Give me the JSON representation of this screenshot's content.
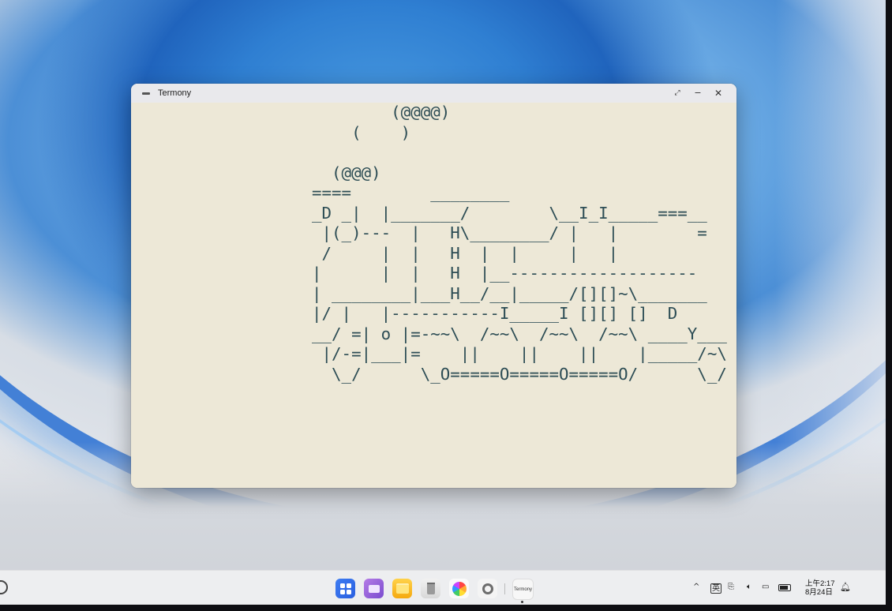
{
  "window": {
    "title": "Termony",
    "controls": {
      "restore": "⤢",
      "minimize": "−",
      "close": "✕"
    }
  },
  "terminal": {
    "content": "        (@@@@)\n    (    )\n\n  (@@@)\n====        ________\n_D _|  |_______/        \\__I_I_____===__\n |(_)---  |   H\\________/ |   |        =\n /     |  |   H  |  |     |   |\n|      |  |   H  |__-------------------\n| ________|___H__/__|_____/[][]~\\_______\n|/ |   |-----------I_____I [][] []  D\n__/ =| o |=-~~\\  /~~\\  /~~\\  /~~\\ ____Y___\n |/-=|___|=    ||    ||    ||    |_____/~\\\n  \\_/      \\_O=====O=====O=====O/      \\_/"
  },
  "taskbar": {
    "dock": [
      {
        "name": "launcher",
        "icon": "grid-icon"
      },
      {
        "name": "multitasking",
        "icon": "windows-icon"
      },
      {
        "name": "files",
        "icon": "folder-icon"
      },
      {
        "name": "trash",
        "icon": "trash-icon"
      },
      {
        "name": "gallery",
        "icon": "flower-icon"
      },
      {
        "name": "settings",
        "icon": "gear-icon"
      },
      {
        "name": "termony",
        "icon": "termony-icon",
        "label": "Termony"
      }
    ],
    "tray": {
      "expand": "^",
      "ime": "英",
      "clipboard": "clipboard-icon",
      "volume": "speaker-icon",
      "cast": "cast-icon",
      "battery": "battery-icon",
      "time": "上午2:17",
      "date": "8月24日",
      "notifications": "bell-icon"
    }
  },
  "colors": {
    "terminal_bg": "#ede8d7",
    "terminal_fg": "#2d4d55",
    "accent": "#2a5fe0"
  }
}
